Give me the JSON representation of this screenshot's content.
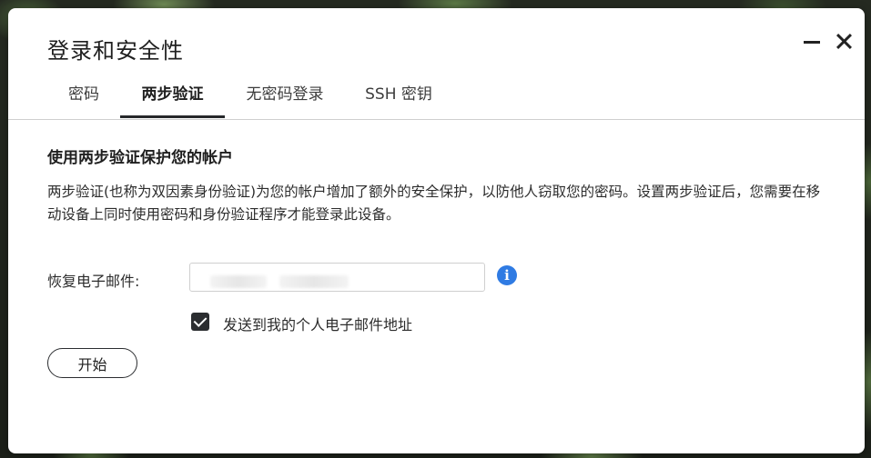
{
  "window": {
    "title": "登录和安全性"
  },
  "tabs": [
    {
      "label": "密码",
      "active": false
    },
    {
      "label": "两步验证",
      "active": true
    },
    {
      "label": "无密码登录",
      "active": false
    },
    {
      "label": "SSH 密钥",
      "active": false
    }
  ],
  "section": {
    "heading": "使用两步验证保护您的帐户",
    "description": "两步验证(也称为双因素身份验证)为您的帐户增加了额外的安全保护，以防他人窃取您的密码。设置两步验证后，您需要在移动设备上同时使用密码和身份验证程序才能登录此设备。"
  },
  "recovery_email": {
    "label": "恢复电子邮件:",
    "value": ""
  },
  "checkbox": {
    "label": "发送到我的个人电子邮件地址",
    "checked": true
  },
  "start_button": {
    "label": "开始"
  },
  "colors": {
    "info_icon": "#2f7be3",
    "active_tab_underline": "#26282b",
    "checkbox_fill": "#2b2d30"
  }
}
